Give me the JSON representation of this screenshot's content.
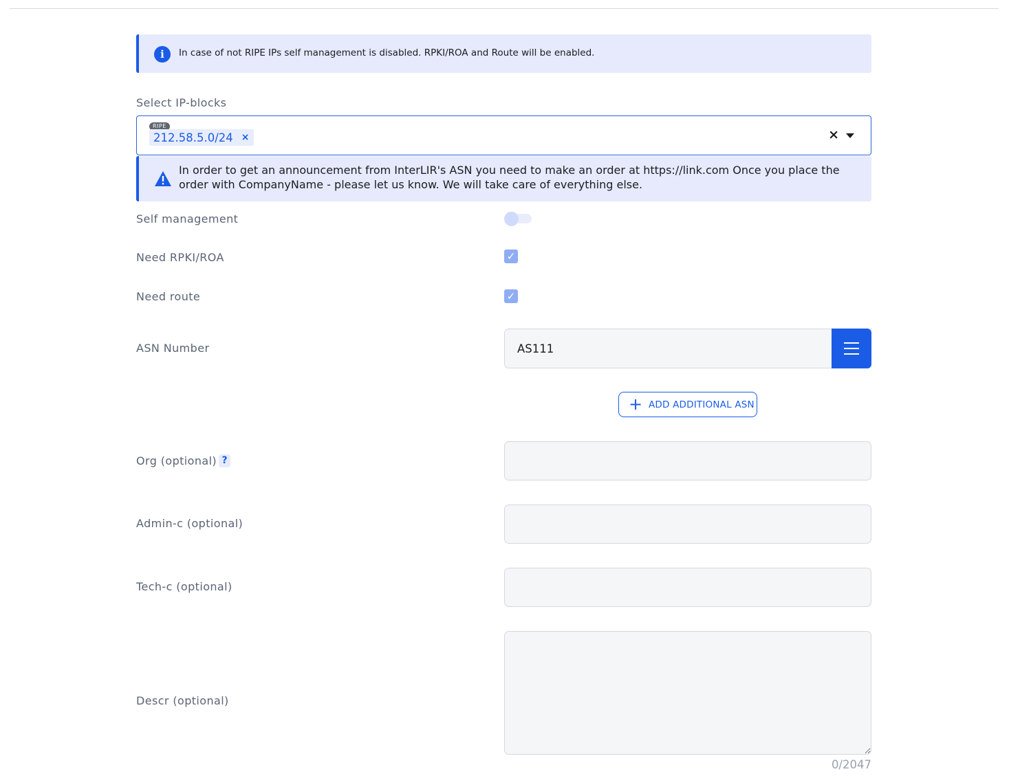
{
  "info_alert": {
    "text": "In case of not RIPE IPs self management is disabled. RPKI/ROA and Route will be enabled."
  },
  "ip_blocks": {
    "label": "Select IP-blocks",
    "selected": [
      {
        "badge": "RIPE",
        "value": "212.58.5.0/24",
        "remove": "×"
      }
    ],
    "clear": "×"
  },
  "warning_alert": {
    "text": "In order to get an announcement from InterLIR's ASN you need to make an order at https://link.com Once you place the order with CompanyName - please let us know. We will take care of everything else."
  },
  "self_management": {
    "label": "Self management",
    "enabled": false
  },
  "need_rpki": {
    "label": "Need RPKI/ROA",
    "checked": true,
    "check": "✓"
  },
  "need_route": {
    "label": "Need route",
    "checked": true,
    "check": "✓"
  },
  "asn": {
    "label": "ASN Number",
    "value": "AS111",
    "add_label": "ADD ADDITIONAL ASN",
    "add_icon": "+"
  },
  "org": {
    "label": "Org (optional)",
    "help": "?",
    "value": ""
  },
  "admin_c": {
    "label": "Admin-c (optional)",
    "value": ""
  },
  "tech_c": {
    "label": "Tech-c (optional)",
    "value": ""
  },
  "descr": {
    "label": "Descr (optional)",
    "value": "",
    "counter": "0/2047"
  },
  "colors": {
    "accent": "#1a5ce6",
    "alert_bg": "#e6eafc",
    "checkbox": "#8fadf3"
  }
}
